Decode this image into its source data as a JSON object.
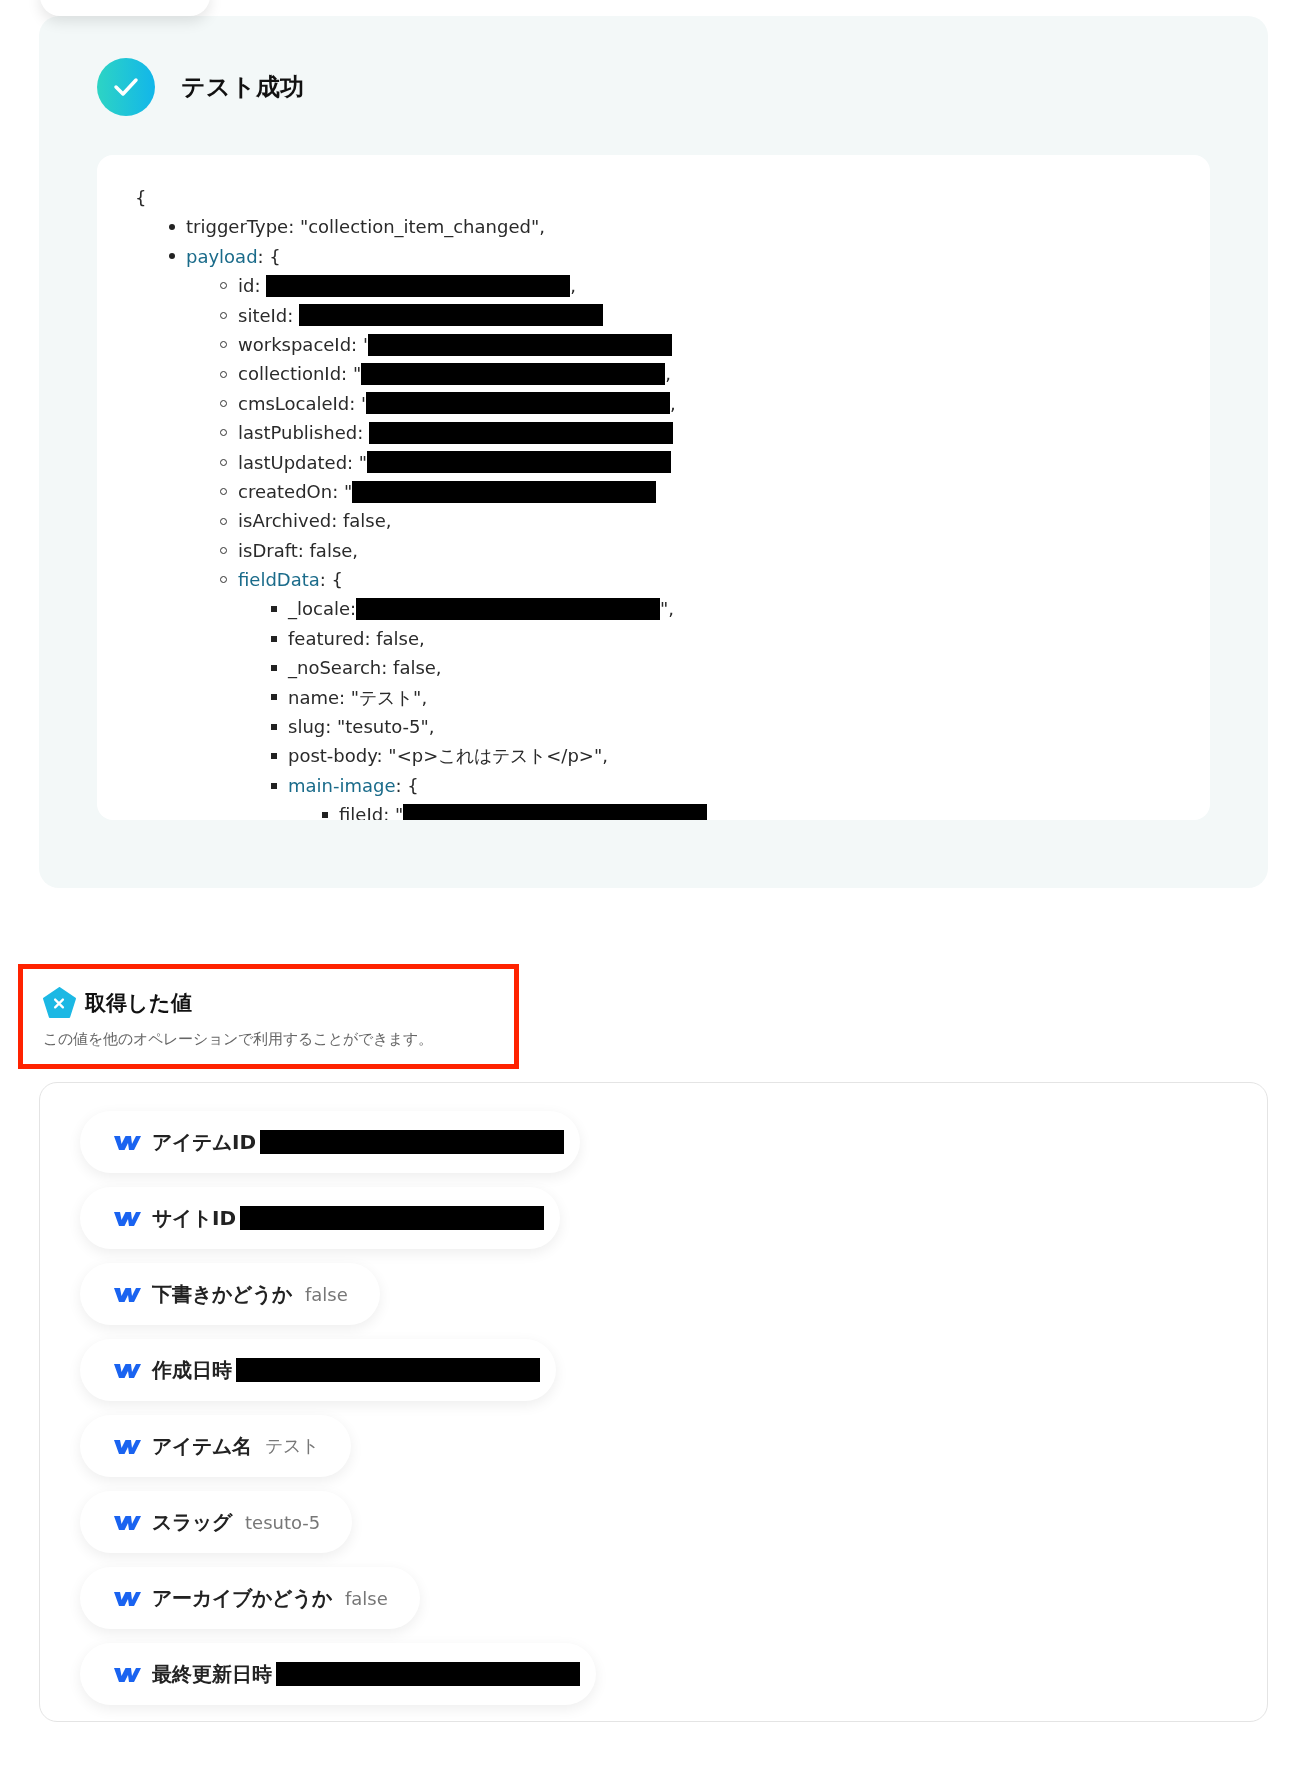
{
  "test_result": {
    "title": "テスト成功",
    "success": true,
    "code": {
      "open": "{",
      "lines": [
        {
          "text": "triggerType: \"collection_item_changed\","
        },
        {
          "key": "payload",
          "text": ": {",
          "children": [
            {
              "text": "id: ",
              "redacted": true,
              "suffix": ","
            },
            {
              "text": "siteId: ",
              "redacted": true
            },
            {
              "text": "workspaceId: '",
              "redacted": true
            },
            {
              "text": "collectionId: \"",
              "redacted": true,
              "suffix": ","
            },
            {
              "text": "cmsLocaleId: '",
              "redacted": true,
              "suffix": ","
            },
            {
              "text": "lastPublished: ",
              "redacted": true
            },
            {
              "text": "lastUpdated: \"",
              "redacted": true
            },
            {
              "text": "createdOn: \"",
              "redacted": true
            },
            {
              "text": "isArchived: false,"
            },
            {
              "text": "isDraft: false,"
            },
            {
              "key": "fieldData",
              "text": ": {",
              "children": [
                {
                  "text": "_locale:",
                  "redacted": true,
                  "suffix": "\","
                },
                {
                  "text": "featured: false,"
                },
                {
                  "text": "_noSearch: false,"
                },
                {
                  "text": "name: \"テスト\","
                },
                {
                  "text": "slug: \"tesuto-5\","
                },
                {
                  "text": "post-body: \"<p>これはテスト</p>\","
                },
                {
                  "key": "main-image",
                  "text": ": {",
                  "children": [
                    {
                      "text": "fileId: \"",
                      "redacted": true
                    }
                  ]
                }
              ]
            }
          ]
        }
      ]
    }
  },
  "retrieved_values": {
    "title": "取得した値",
    "description": "この値を他のオペレーションで利用することができます。",
    "highlighted": true,
    "items": [
      {
        "label": "アイテムID",
        "kind": "redacted"
      },
      {
        "label": "サイトID",
        "kind": "redacted"
      },
      {
        "label": "下書きかどうか",
        "kind": "text",
        "value": "false"
      },
      {
        "label": "作成日時",
        "kind": "redacted"
      },
      {
        "label": "アイテム名",
        "kind": "text",
        "value": "テスト"
      },
      {
        "label": "スラッグ",
        "kind": "text",
        "value": "tesuto-5"
      },
      {
        "label": "アーカイブかどうか",
        "kind": "text",
        "value": "false"
      },
      {
        "label": "最終更新日時",
        "kind": "redacted"
      }
    ]
  }
}
